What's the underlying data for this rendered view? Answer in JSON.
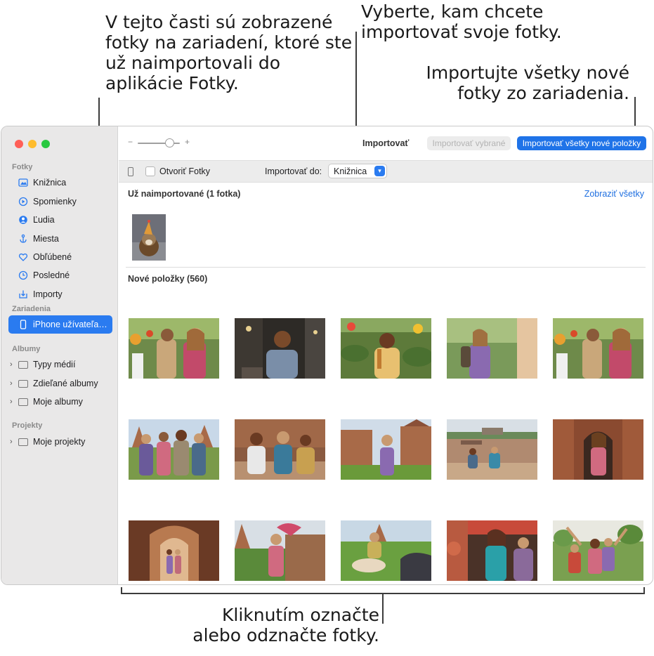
{
  "callouts": {
    "imported": "V tejto časti sú zobrazené fotky na zariadení, ktoré ste už naimportovali do aplikácie Fotky.",
    "destination": "Vyberte, kam chcete importovať svoje fotky.",
    "import_all": "Importujte všetky nové fotky zo zariadenia.",
    "select": "Kliknutím označte alebo odznačte fotky."
  },
  "sidebar": {
    "sections": {
      "photos": "Fotky",
      "devices": "Zariadenia",
      "albums": "Albumy",
      "projects": "Projekty"
    },
    "items": [
      {
        "label": "Knižnica",
        "icon": "library-icon"
      },
      {
        "label": "Spomienky",
        "icon": "memories-icon"
      },
      {
        "label": "Ľudia",
        "icon": "people-icon"
      },
      {
        "label": "Miesta",
        "icon": "places-icon"
      },
      {
        "label": "Obľúbené",
        "icon": "heart-icon"
      },
      {
        "label": "Posledné",
        "icon": "clock-icon"
      },
      {
        "label": "Importy",
        "icon": "imports-icon"
      }
    ],
    "device": "iPhone užívateľa…",
    "album_groups": [
      "Typy médií",
      "Zdieľané albumy",
      "Moje albumy"
    ],
    "project_groups": [
      "Moje projekty"
    ]
  },
  "toolbar": {
    "slider_minus": "−",
    "slider_plus": "+",
    "title": "Importovať",
    "import_selected": "Importovať vybrané",
    "import_all": "Importovať všetky nové položky"
  },
  "options": {
    "open_photos": "Otvoriť Fotky",
    "import_to_label": "Importovať do:",
    "import_to_value": "Knižnica"
  },
  "content": {
    "already_imported_title": "Už naimportované (1 fotka)",
    "show_all": "Zobraziť všetky",
    "new_items_title": "Nové položky (560)"
  },
  "colors": {
    "accent": "#1f73e8",
    "sidebar_bg": "#e9e8e8",
    "close": "#ff5f57",
    "minimize": "#febc2e",
    "zoom": "#28c840"
  }
}
